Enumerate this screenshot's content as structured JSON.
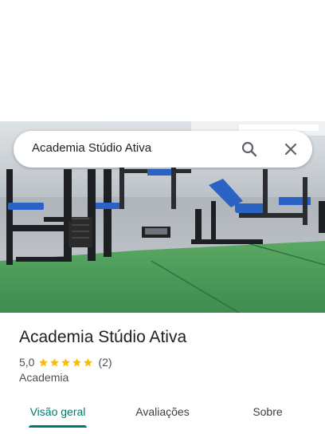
{
  "search": {
    "query": "Academia Stúdio Ativa",
    "search_icon": "search-icon",
    "close_icon": "close-icon"
  },
  "place": {
    "name": "Academia Stúdio Ativa",
    "rating": "5,0",
    "stars": 5,
    "review_count": "(2)",
    "category": "Academia"
  },
  "tabs": [
    {
      "label": "Visão geral",
      "active": true
    },
    {
      "label": "Avaliações",
      "active": false
    },
    {
      "label": "Sobre",
      "active": false
    }
  ],
  "colors": {
    "accent": "#00796b",
    "star": "#fbbc04",
    "turf": "#3e8c4f"
  }
}
